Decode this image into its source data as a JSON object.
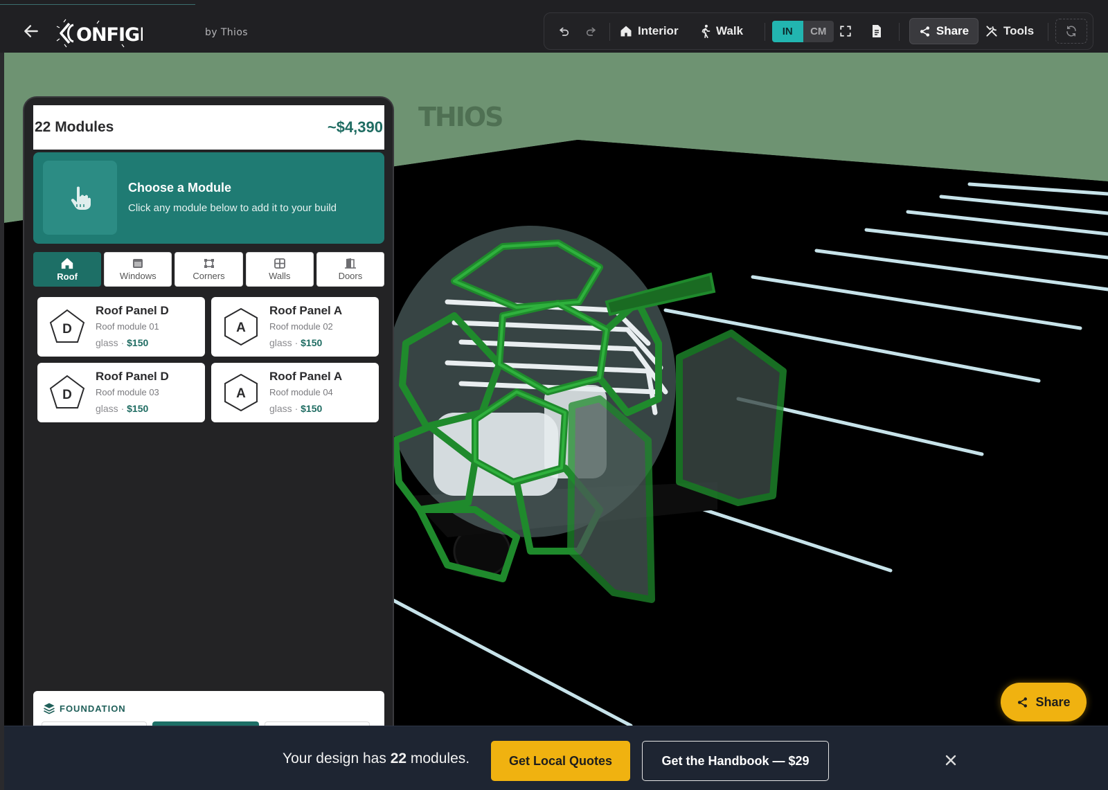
{
  "header": {
    "logo_text": "CONFIGR",
    "byline": "by Thios",
    "toolbar": {
      "undo_icon": "undo-icon",
      "redo_icon": "redo-icon",
      "interior_label": "Interior",
      "walk_label": "Walk",
      "units": [
        "IN",
        "CM"
      ],
      "active_unit": "IN",
      "fullscreen_icon": "fullscreen-icon",
      "document_icon": "document-icon",
      "share_label": "Share",
      "tools_label": "Tools",
      "refresh_icon": "refresh-icon"
    }
  },
  "scene": {
    "watermark": "THIOS",
    "colors": {
      "sky": "#6e9372",
      "ground": "#000000",
      "lines": "#c7e3ea",
      "frame": "#1f8a2c"
    }
  },
  "panel": {
    "module_count_label": "22 Modules",
    "price_label": "~$4,390",
    "prompt": {
      "title": "Choose a Module",
      "subtitle": "Click any module below to add it to your build"
    },
    "tabs": [
      {
        "label": "Roof",
        "icon": "home-icon",
        "active": true
      },
      {
        "label": "Windows",
        "icon": "window-icon",
        "active": false
      },
      {
        "label": "Corners",
        "icon": "corners-icon",
        "active": false
      },
      {
        "label": "Walls",
        "icon": "walls-icon",
        "active": false
      },
      {
        "label": "Doors",
        "icon": "door-icon",
        "active": false
      }
    ],
    "modules": [
      {
        "badge": "D",
        "title": "Roof Panel D",
        "subtitle": "Roof module 01",
        "material": "glass",
        "sep": " · ",
        "price": "$150"
      },
      {
        "badge": "A",
        "title": "Roof Panel A",
        "subtitle": "Roof module 02",
        "material": "glass",
        "sep": " · ",
        "price": "$150"
      },
      {
        "badge": "D",
        "title": "Roof Panel D",
        "subtitle": "Roof module 03",
        "material": "glass",
        "sep": " · ",
        "price": "$150"
      },
      {
        "badge": "A",
        "title": "Roof Panel A",
        "subtitle": "Roof module 04",
        "material": "glass",
        "sep": " · ",
        "price": "$150"
      }
    ],
    "foundation_label": "FOUNDATION"
  },
  "share_fab_label": "Share",
  "banner": {
    "text_before": "Your design has ",
    "module_count": "22",
    "text_after": " modules.",
    "quotes_label": "Get Local Quotes",
    "handbook_label": "Get the Handbook — $29"
  },
  "theme": {
    "accent": "#22b5b0",
    "teal_dark": "#1d6f66",
    "cta_yellow": "#f0b210",
    "banner_bg": "#1e2532"
  }
}
